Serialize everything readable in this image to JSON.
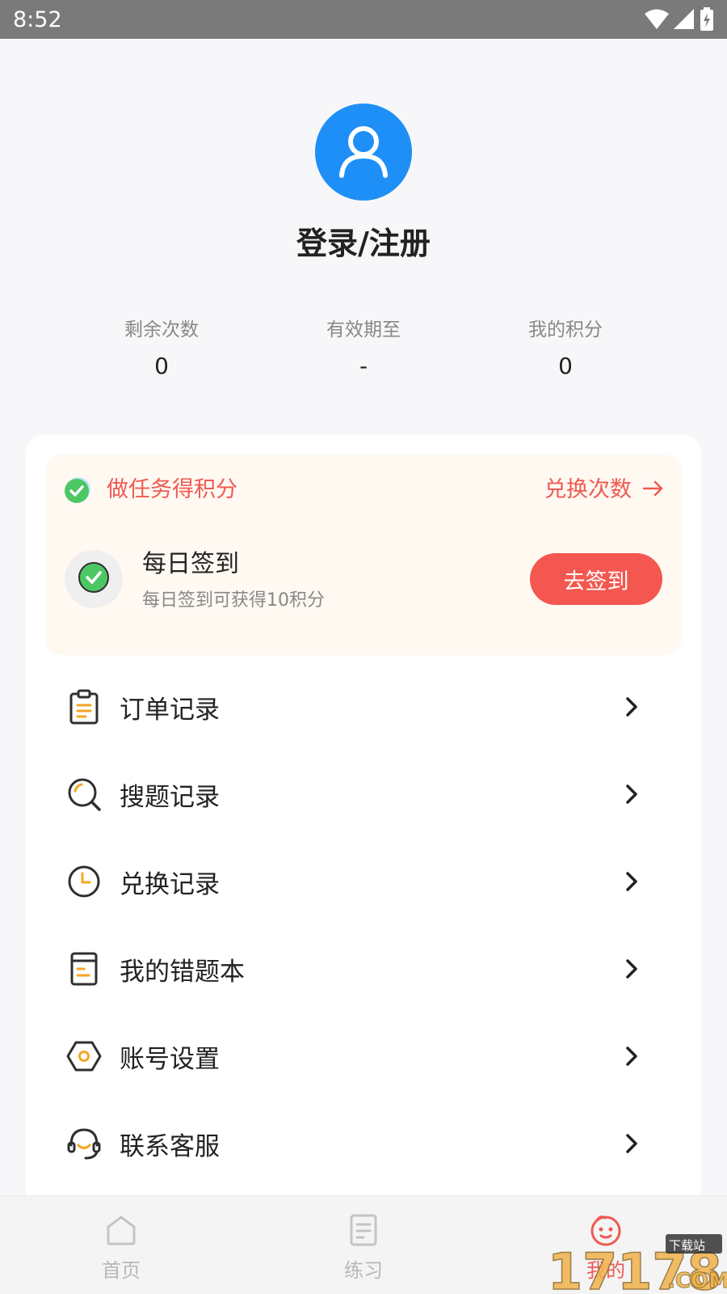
{
  "status_bar": {
    "time": "8:52"
  },
  "profile": {
    "login_label": "登录/注册"
  },
  "stats": [
    {
      "label": "剩余次数",
      "value": "0"
    },
    {
      "label": "有效期至",
      "value": "-"
    },
    {
      "label": "我的积分",
      "value": "0"
    }
  ],
  "task_section": {
    "title": "做任务得积分",
    "exchange_label": "兑换次数",
    "checkin": {
      "title": "每日签到",
      "description": "每日签到可获得10积分",
      "button_label": "去签到"
    }
  },
  "menu": [
    {
      "label": "订单记录",
      "icon": "clipboard-icon"
    },
    {
      "label": "搜题记录",
      "icon": "search-icon"
    },
    {
      "label": "兑换记录",
      "icon": "clock-icon"
    },
    {
      "label": "我的错题本",
      "icon": "notebook-icon"
    },
    {
      "label": "账号设置",
      "icon": "settings-icon"
    },
    {
      "label": "联系客服",
      "icon": "headset-icon"
    }
  ],
  "bottom_nav": [
    {
      "label": "首页",
      "icon": "home-icon",
      "active": false
    },
    {
      "label": "练习",
      "icon": "practice-icon",
      "active": false
    },
    {
      "label": "我的",
      "icon": "profile-face-icon",
      "active": true
    }
  ],
  "watermark": {
    "text": "17178",
    "sub": "下载站",
    "domain": ".COM"
  },
  "colors": {
    "accent": "#ef5a52",
    "avatar": "#1e8ff7",
    "icon_orange": "#f5a623",
    "check_green": "#4cc764"
  }
}
